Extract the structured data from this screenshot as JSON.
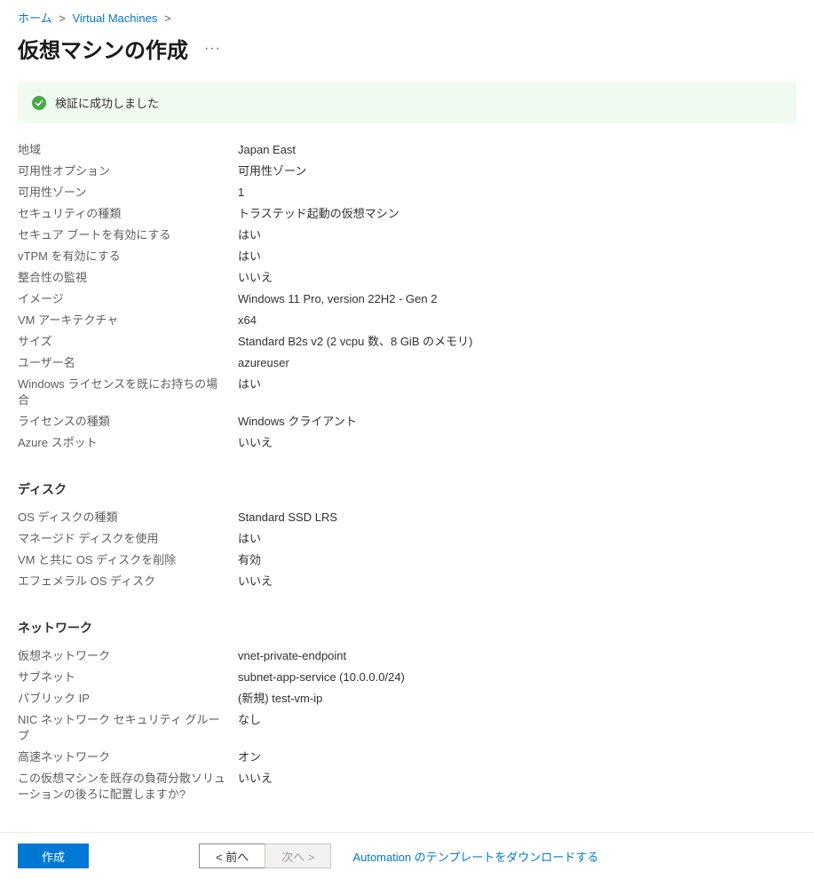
{
  "breadcrumb": {
    "home": "ホーム",
    "vms": "Virtual Machines"
  },
  "page": {
    "title": "仮想マシンの作成"
  },
  "banner": {
    "text": "検証に成功しました"
  },
  "sections": {
    "basic": {
      "rows": [
        {
          "label": "地域",
          "value": "Japan East"
        },
        {
          "label": "可用性オプション",
          "value": "可用性ゾーン"
        },
        {
          "label": "可用性ゾーン",
          "value": "1"
        },
        {
          "label": "セキュリティの種類",
          "value": "トラステッド起動の仮想マシン"
        },
        {
          "label": "セキュア ブートを有効にする",
          "value": "はい"
        },
        {
          "label": "vTPM を有効にする",
          "value": "はい"
        },
        {
          "label": "整合性の監視",
          "value": "いいえ"
        },
        {
          "label": "イメージ",
          "value": "Windows 11 Pro, version 22H2 - Gen 2"
        },
        {
          "label": "VM アーキテクチャ",
          "value": "x64"
        },
        {
          "label": "サイズ",
          "value": "Standard B2s v2 (2 vcpu 数、8 GiB のメモリ)"
        },
        {
          "label": "ユーザー名",
          "value": "azureuser"
        },
        {
          "label": "Windows ライセンスを既にお持ちの場合",
          "value": "はい"
        },
        {
          "label": "ライセンスの種類",
          "value": "Windows クライアント"
        },
        {
          "label": "Azure スポット",
          "value": "いいえ"
        }
      ]
    },
    "disk": {
      "title": "ディスク",
      "rows": [
        {
          "label": "OS ディスクの種類",
          "value": "Standard SSD LRS"
        },
        {
          "label": "マネージド ディスクを使用",
          "value": "はい"
        },
        {
          "label": "VM と共に OS ディスクを削除",
          "value": "有効"
        },
        {
          "label": "エフェメラル OS ディスク",
          "value": "いいえ"
        }
      ]
    },
    "network": {
      "title": "ネットワーク",
      "rows": [
        {
          "label": "仮想ネットワーク",
          "value": "vnet-private-endpoint"
        },
        {
          "label": "サブネット",
          "value": "subnet-app-service (10.0.0.0/24)"
        },
        {
          "label": "パブリック IP",
          "value": "(新規) test-vm-ip"
        },
        {
          "label": "NIC ネットワーク セキュリティ グループ",
          "value": "なし"
        },
        {
          "label": "高速ネットワーク",
          "value": "オン"
        },
        {
          "label": "この仮想マシンを既存の負荷分散ソリューションの後ろに配置しますか?",
          "value": "いいえ"
        }
      ]
    }
  },
  "footer": {
    "create": "作成",
    "prev": "< 前へ",
    "next": "次へ >",
    "download": "Automation のテンプレートをダウンロードする"
  }
}
